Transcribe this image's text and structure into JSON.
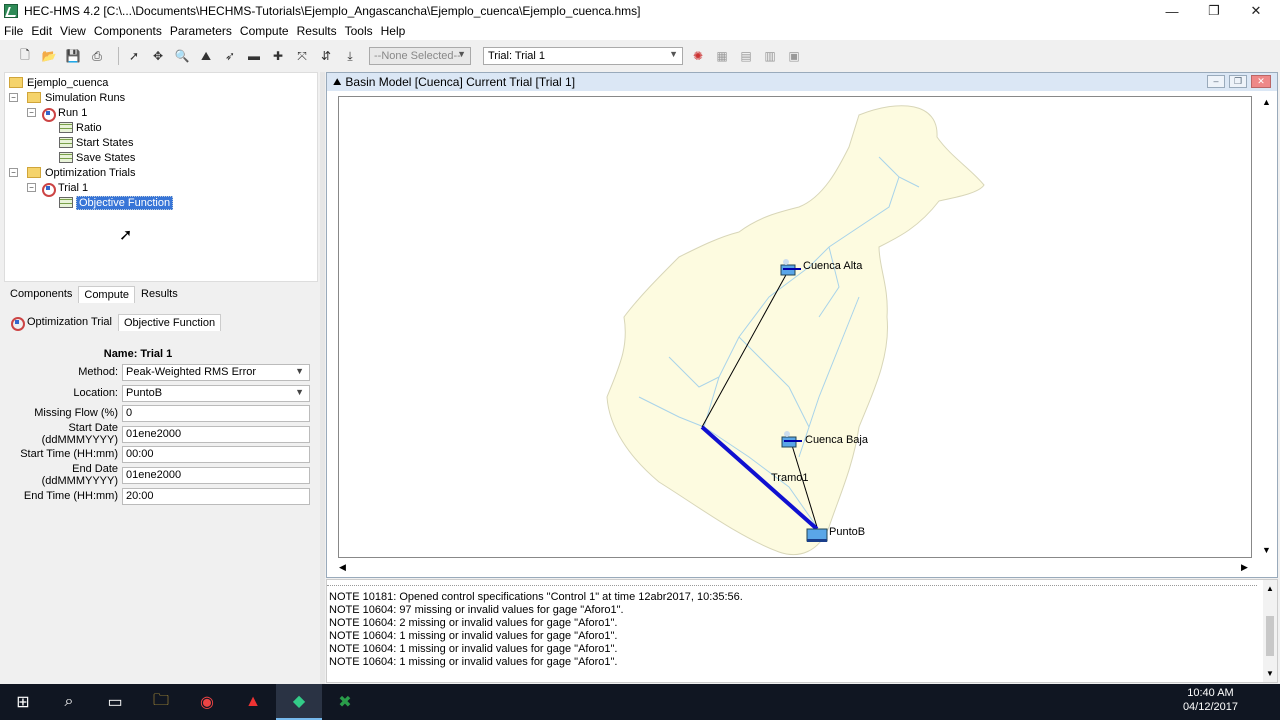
{
  "window": {
    "title": "HEC-HMS 4.2 [C:\\...\\Documents\\HECHMS-Tutorials\\Ejemplo_Angascancha\\Ejemplo_cuenca\\Ejemplo_cuenca.hms]",
    "minimize": "—",
    "restore": "❐",
    "close": "✕"
  },
  "menu": [
    "File",
    "Edit",
    "View",
    "Components",
    "Parameters",
    "Compute",
    "Results",
    "Tools",
    "Help"
  ],
  "toolbar": {
    "selector_value": "--None Selected--",
    "trial_value": "Trial: Trial 1"
  },
  "tree": {
    "project": "Ejemplo_cuenca",
    "simulation_runs": "Simulation Runs",
    "run1": "Run 1",
    "ratio": "Ratio",
    "start_states": "Start States",
    "save_states": "Save States",
    "optimization_trials": "Optimization Trials",
    "trial1": "Trial 1",
    "objective_function": "Objective Function"
  },
  "explorer_tabs": [
    "Components",
    "Compute",
    "Results"
  ],
  "editor_tabs": [
    "Optimization Trial",
    "Objective Function"
  ],
  "form": {
    "name": "Name: Trial 1",
    "method_label": "Method:",
    "method_value": "Peak-Weighted RMS Error",
    "location_label": "Location:",
    "location_value": "PuntoB",
    "missing_label": "Missing Flow (%)",
    "missing_value": "0",
    "start_date_label": "Start Date (ddMMMYYYY)",
    "start_date_value": "01ene2000",
    "start_time_label": "Start Time (HH:mm)",
    "start_time_value": "00:00",
    "end_date_label": "End Date (ddMMMYYYY)",
    "end_date_value": "01ene2000",
    "end_time_label": "End Time (HH:mm)",
    "end_time_value": "20:00"
  },
  "basin": {
    "title": "Basin Model [Cuenca] Current Trial [Trial 1]",
    "labels": {
      "cuenca_alta": "Cuenca Alta",
      "cuenca_baja": "Cuenca Baja",
      "tramo1": "Tramo1",
      "puntob": "PuntoB"
    }
  },
  "log": [
    "NOTE 10181: Opened control specifications \"Control 1\" at time 12abr2017, 10:35:56.",
    "NOTE 10604: 97 missing or invalid values for gage \"Aforo1\".",
    "NOTE 10604: 2 missing or invalid values for gage \"Aforo1\".",
    "NOTE 10604: 1 missing or invalid values for gage \"Aforo1\".",
    "NOTE 10604: 1 missing or invalid values for gage \"Aforo1\".",
    "NOTE 10604: 1 missing or invalid values for gage \"Aforo1\"."
  ],
  "taskbar": {
    "time": "10:40 AM",
    "date": "04/12/2017"
  }
}
